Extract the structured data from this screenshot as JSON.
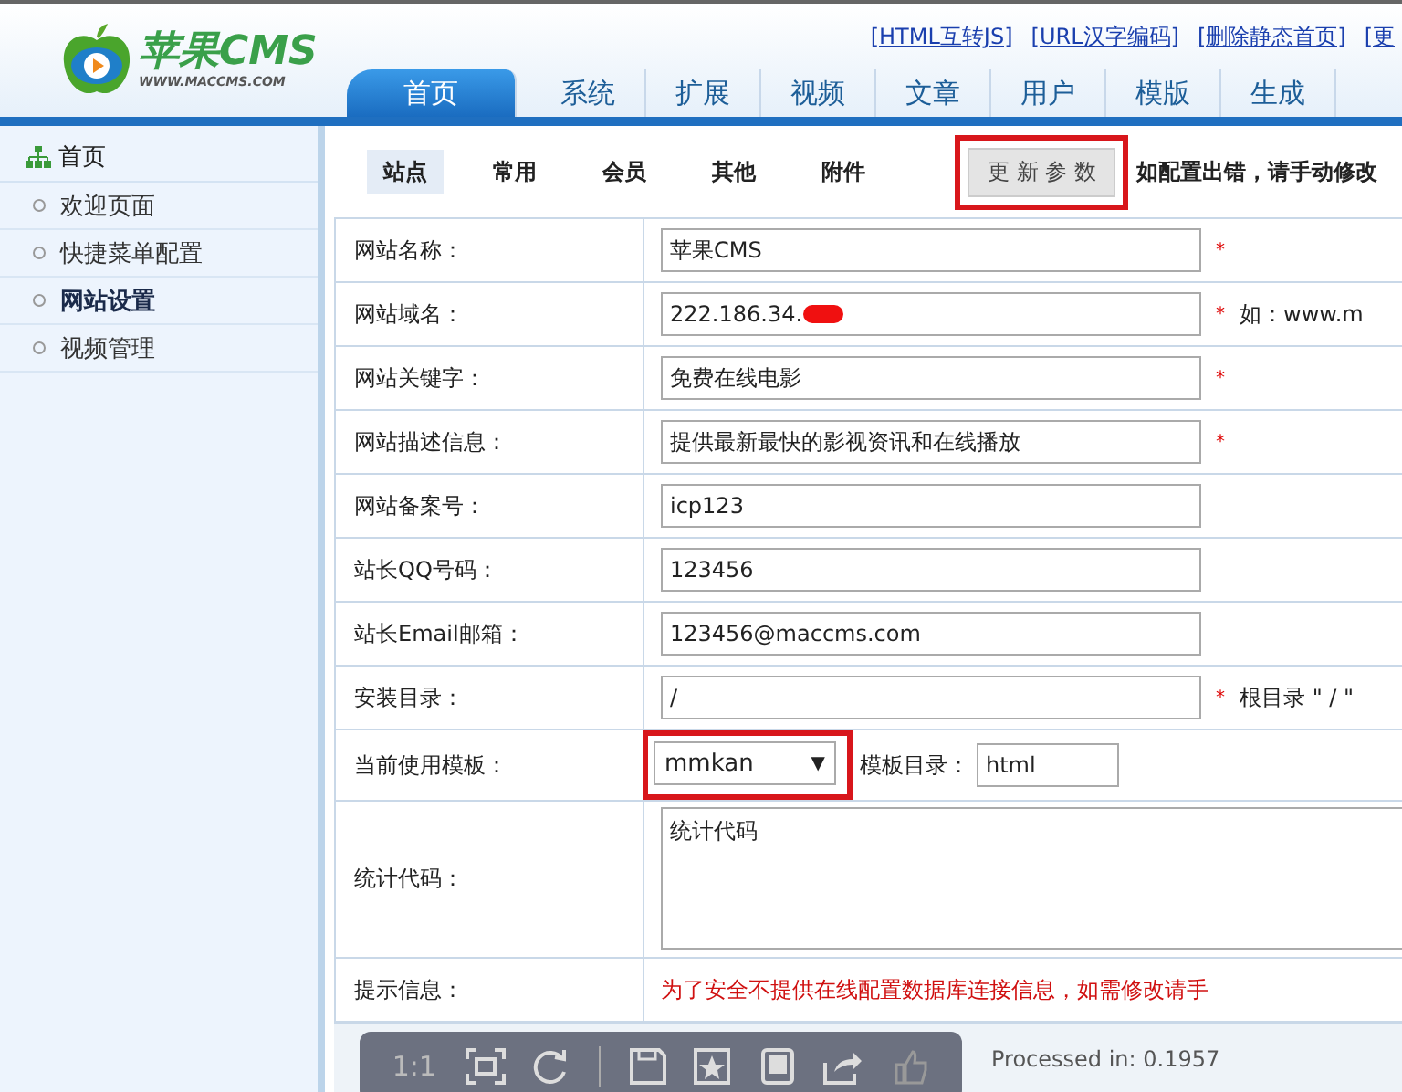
{
  "header": {
    "logo_text": "苹果CMS",
    "logo_url": "WWW.MACCMS.COM",
    "links": [
      "[HTML互转JS]",
      "[URL汉字编码]",
      "[删除静态首页]",
      "[更"
    ],
    "nav": [
      {
        "label": "首页",
        "selected": true
      },
      {
        "label": "系统",
        "selected": false
      },
      {
        "label": "扩展",
        "selected": false
      },
      {
        "label": "视频",
        "selected": false
      },
      {
        "label": "文章",
        "selected": false
      },
      {
        "label": "用户",
        "selected": false
      },
      {
        "label": "模版",
        "selected": false
      },
      {
        "label": "生成",
        "selected": false
      }
    ]
  },
  "sidebar": {
    "title": "首页",
    "items": [
      {
        "label": "欢迎页面",
        "selected": false
      },
      {
        "label": "快捷菜单配置",
        "selected": false
      },
      {
        "label": "网站设置",
        "selected": true
      },
      {
        "label": "视频管理",
        "selected": false
      }
    ]
  },
  "subtabs": [
    {
      "label": "站点",
      "selected": true
    },
    {
      "label": "常用",
      "selected": false
    },
    {
      "label": "会员",
      "selected": false
    },
    {
      "label": "其他",
      "selected": false
    },
    {
      "label": "附件",
      "selected": false
    }
  ],
  "update_button": "更 新 参 数",
  "update_note": "如配置出错，请手动修改",
  "form": [
    {
      "kind": "input",
      "label": "网站名称：",
      "value": "苹果CMS",
      "mark": "*"
    },
    {
      "kind": "input",
      "label": "网站域名：",
      "value": "222.186.34.",
      "redacted": true,
      "mark": "*",
      "hint": "如：www.m"
    },
    {
      "kind": "input",
      "label": "网站关键字：",
      "value": "免费在线电影",
      "mark": "*"
    },
    {
      "kind": "input",
      "label": "网站描述信息：",
      "value": "提供最新最快的影视资讯和在线播放",
      "mark": "*"
    },
    {
      "kind": "input",
      "label": "网站备案号：",
      "value": "icp123"
    },
    {
      "kind": "input",
      "label": "站长QQ号码：",
      "value": "123456"
    },
    {
      "kind": "input",
      "label": "站长Email邮箱：",
      "value": "123456@maccms.com"
    },
    {
      "kind": "input",
      "label": "安装目录：",
      "value": "/",
      "mark": "*",
      "hint": "根目录 \" / \""
    },
    {
      "kind": "select",
      "label": "当前使用模板：",
      "value": "mmkan",
      "caret": "▼",
      "extra_label": "模板目录：",
      "extra_value": "html"
    },
    {
      "kind": "textarea",
      "label": "统计代码：",
      "value": "统计代码"
    },
    {
      "kind": "note",
      "label": "提示信息：",
      "value": "为了安全不提供在线配置数据库连接信息，如需修改请手"
    }
  ],
  "footer": "Processed in: 0.1957",
  "viewer_toolbar": {
    "zoom_label": "1:1"
  }
}
